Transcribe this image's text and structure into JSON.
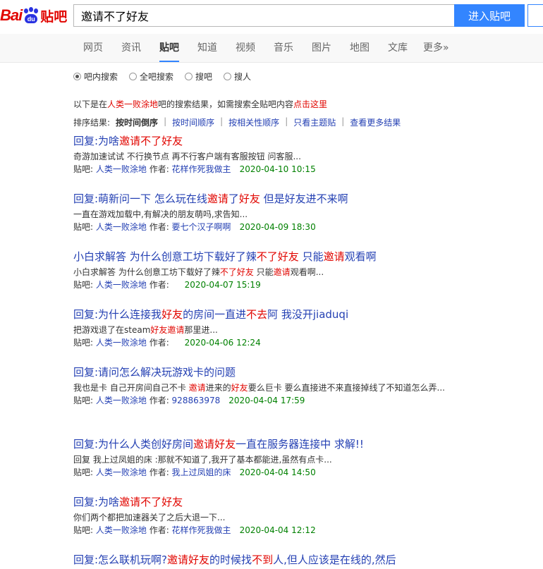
{
  "logo": {
    "bai": "Bai",
    "du": "du",
    "tieba": "贴吧"
  },
  "search": {
    "query": "邀请不了好友",
    "button_label": "进入贴吧"
  },
  "nav": [
    "网页",
    "资讯",
    "贴吧",
    "知道",
    "视频",
    "音乐",
    "图片",
    "地图",
    "文库",
    "更多»"
  ],
  "nav_active": "贴吧",
  "scope": {
    "options": [
      "吧内搜索",
      "全吧搜索",
      "搜吧",
      "搜人"
    ],
    "selected": "吧内搜索"
  },
  "info": {
    "pre": "以下是在",
    "forum": "人类一败涂地",
    "mid": "吧的搜索结果，如需搜索全贴吧内容",
    "link": "点击这里"
  },
  "sort": {
    "label": "排序结果:",
    "current": "按时间倒序",
    "links": [
      "按时间顺序",
      "按相关性顺序",
      "只看主题贴",
      "查看更多结果"
    ]
  },
  "meta_labels": {
    "forum": "贴吧:",
    "author": "作者:"
  },
  "results": [
    {
      "title": [
        [
          "回复:为啥",
          false
        ],
        [
          "邀请不了好友",
          true
        ]
      ],
      "snippet": [
        [
          "奇游加速试试 不行换节点 再不行客户端有客服按钮 问客服...",
          false
        ]
      ],
      "forum": "人类一败涂地",
      "author": "花样作死我做主",
      "date": "2020-04-10 10:15"
    },
    {
      "title": [
        [
          "回复:萌新问一下 怎么玩在线",
          false
        ],
        [
          "邀请",
          true
        ],
        [
          "了",
          false
        ],
        [
          "好友",
          true
        ],
        [
          " 但是好友进不来啊",
          false
        ]
      ],
      "snippet": [
        [
          "一直在游戏加载中,有解决的朋友萌吗,求告知...",
          false
        ]
      ],
      "forum": "人类一败涂地",
      "author": "要七个汉子啊啊",
      "date": "2020-04-09 18:30"
    },
    {
      "title": [
        [
          "小白求解答 为什么创意工坊下载好了辣",
          false
        ],
        [
          "不了好友",
          true
        ],
        [
          " 只能",
          false
        ],
        [
          "邀请",
          true
        ],
        [
          "观看啊",
          false
        ]
      ],
      "snippet": [
        [
          "小白求解答 为什么创意工坊下载好了辣",
          false
        ],
        [
          "不了好友",
          true
        ],
        [
          " 只能",
          false
        ],
        [
          "邀请",
          true
        ],
        [
          "观看啊...",
          false
        ]
      ],
      "forum": "人类一败涂地",
      "author": "",
      "date": "2020-04-07 15:19"
    },
    {
      "title": [
        [
          "回复:为什么连接我",
          false
        ],
        [
          "好友",
          true
        ],
        [
          "的房间一直进",
          false
        ],
        [
          "不去",
          true
        ],
        [
          "阿 我没开jiaduqi",
          false
        ]
      ],
      "snippet": [
        [
          "把游戏退了在steam",
          false
        ],
        [
          "好友邀请",
          true
        ],
        [
          "那里进...",
          false
        ]
      ],
      "forum": "人类一败涂地",
      "author": "",
      "date": "2020-04-06 12:24"
    },
    {
      "title": [
        [
          "回复:请问怎么解决玩游戏卡的问题",
          false
        ]
      ],
      "snippet": [
        [
          "我也是卡 自己开房间自己不卡 ",
          false
        ],
        [
          "邀请",
          true
        ],
        [
          "进来的",
          false
        ],
        [
          "好友",
          true
        ],
        [
          "要么巨卡 要么直接进不来直接掉线了不知道怎么弄...",
          false
        ]
      ],
      "forum": "人类一败涂地",
      "author": "928863978",
      "date": "2020-04-04 17:59"
    },
    {
      "title": [
        [
          "回复:为什么人类创好房间",
          false
        ],
        [
          "邀请好友",
          true
        ],
        [
          "一直在服务器连接中 求解!!",
          false
        ]
      ],
      "snippet": [
        [
          "回复 我上过凤姐的床 :那就不知道了,我开了基本都能进,虽然有点卡...",
          false
        ]
      ],
      "forum": "人类一败涂地",
      "author": "我上过凤姐的床",
      "date": "2020-04-04 14:50"
    },
    {
      "title": [
        [
          "回复:为啥",
          false
        ],
        [
          "邀请不了好友",
          true
        ]
      ],
      "snippet": [
        [
          "你们两个都把加速器关了之后大退一下...",
          false
        ]
      ],
      "forum": "人类一败涂地",
      "author": "花样作死我做主",
      "date": "2020-04-04 12:12"
    },
    {
      "title": [
        [
          "回复:怎么联机玩啊?",
          false
        ],
        [
          "邀请好友",
          true
        ],
        [
          "的时候找",
          false
        ],
        [
          "不到",
          true
        ],
        [
          "人,但人应该是在线的,然后",
          false
        ]
      ],
      "snippet": [],
      "forum": "",
      "author": "",
      "date": ""
    }
  ],
  "colors": {
    "accent": "#3385ff",
    "link": "#2440b3",
    "highlight": "#e10601",
    "date": "#008000"
  }
}
